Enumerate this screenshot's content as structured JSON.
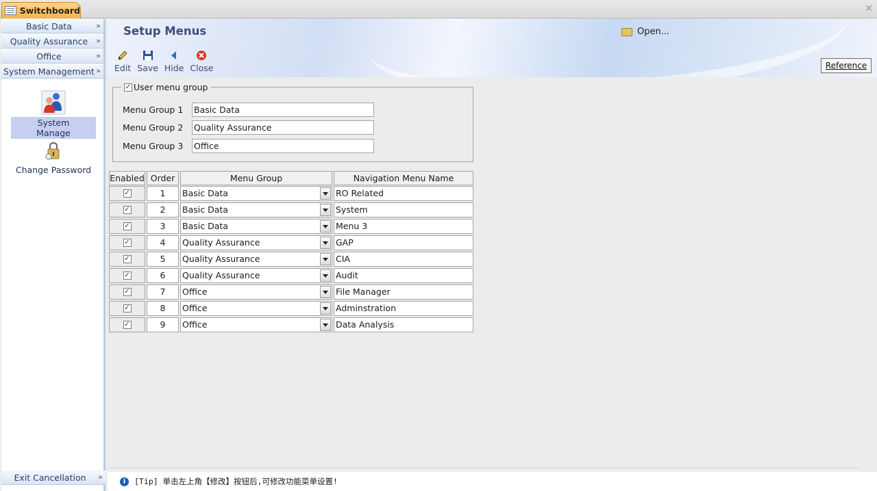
{
  "tab": {
    "title": "Switchboard"
  },
  "window": {
    "close_glyph": "✕"
  },
  "nav": {
    "groups": [
      {
        "label": "Basic Data"
      },
      {
        "label": "Quality Assurance"
      },
      {
        "label": "Office"
      },
      {
        "label": "System Management"
      }
    ],
    "chevron": "»",
    "items": [
      {
        "label": "System Manage",
        "icon": "users-icon",
        "selected": true
      },
      {
        "label": "Change Password",
        "icon": "lock-icon",
        "selected": false
      }
    ],
    "exit_label": "Exit Cancellation"
  },
  "header": {
    "title": "Setup Menus",
    "open_label": "Open...",
    "reference_label": "Reference",
    "toolbar": [
      {
        "label": "Edit",
        "icon": "pencil-icon"
      },
      {
        "label": "Save",
        "icon": "floppy-icon"
      },
      {
        "label": "Hide",
        "icon": "back-arrow-icon"
      },
      {
        "label": "Close",
        "icon": "close-circle-icon"
      }
    ]
  },
  "user_group": {
    "legend": "User menu group",
    "checked": true,
    "fields": [
      {
        "label": "Menu Group 1",
        "value": "Basic Data"
      },
      {
        "label": "Menu Group 2",
        "value": "Quality Assurance"
      },
      {
        "label": "Menu Group 3",
        "value": "Office"
      }
    ]
  },
  "table": {
    "columns": [
      "Enabled",
      "Order",
      "Menu Group",
      "Navigation Menu Name"
    ],
    "rows": [
      {
        "enabled": true,
        "order": "1",
        "group": "Basic Data",
        "name": "RO Related"
      },
      {
        "enabled": true,
        "order": "2",
        "group": "Basic Data",
        "name": "System"
      },
      {
        "enabled": true,
        "order": "3",
        "group": "Basic Data",
        "name": "Menu 3"
      },
      {
        "enabled": true,
        "order": "4",
        "group": "Quality Assurance",
        "name": "GAP"
      },
      {
        "enabled": true,
        "order": "5",
        "group": "Quality Assurance",
        "name": "CIA"
      },
      {
        "enabled": true,
        "order": "6",
        "group": "Quality Assurance",
        "name": "Audit"
      },
      {
        "enabled": true,
        "order": "7",
        "group": "Office",
        "name": "File Manager"
      },
      {
        "enabled": true,
        "order": "8",
        "group": "Office",
        "name": "Adminstration"
      },
      {
        "enabled": true,
        "order": "9",
        "group": "Office",
        "name": "Data Analysis"
      }
    ]
  },
  "footer": {
    "info_glyph": "i",
    "tip": "[Tip] 单击左上角【修改】按钮后,可修改功能菜单设置!"
  },
  "check_glyph": "✓"
}
